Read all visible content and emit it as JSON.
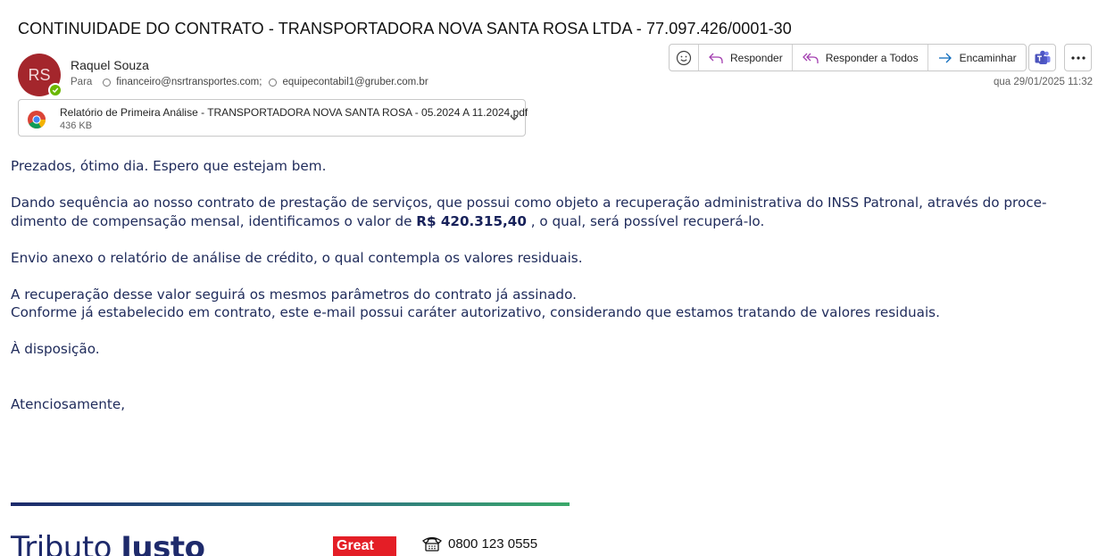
{
  "email": {
    "subject": "CONTINUIDADE DO CONTRATO - TRANSPORTADORA NOVA SANTA ROSA LTDA - 77.097.426/0001-30",
    "sender": {
      "initials": "RS",
      "name": "Raquel Souza",
      "avatar_color": "#a4262c",
      "presence_color": "#6bb700"
    },
    "to_label": "Para",
    "recipients": [
      "financeiro@nsrtransportes.com;",
      "equipecontabil1@gruber.com.br"
    ],
    "date": "qua 29/01/2025 11:32"
  },
  "toolbar": {
    "emoji_icon": "smiley-icon",
    "reply_label": "Responder",
    "reply_all_label": "Responder a Todos",
    "forward_label": "Encaminhar",
    "teams_icon": "teams-icon",
    "more_icon": "more-icon"
  },
  "attachment": {
    "name": "Relatório de Primeira Análise - TRANSPORTADORA NOVA SANTA ROSA - 05.2024 A 11.2024.pdf",
    "size": "436 KB",
    "icon": "chrome-icon"
  },
  "body": {
    "greeting": "Prezados, ótimo dia. Espero que estejam bem.",
    "p2_line1": "Dando sequência ao nosso contrato de prestação de serviços, que possui como objeto a recuperação administrativa do INSS Patronal, através do proce-",
    "p2_line2_pre": "dimento de compensação mensal, identificamos o valor de ",
    "p2_amount": "R$ 420.315,40",
    "p2_line2_post": " , o qual, será possível recuperá-lo.",
    "p3": "Envio anexo o relatório de análise de crédito, o qual contempla os valores residuais.",
    "p4_line1": "A recuperação desse valor seguirá os mesmos parâmetros do contrato já assinado.",
    "p4_line2": "Conforme já estabelecido em contrato, este e-mail possui caráter autorizativo, considerando que estamos tratando de valores residuais.",
    "p5": "À disposição.",
    "closing": "Atenciosamente,"
  },
  "signature": {
    "logo_light": "Tributo ",
    "logo_bold": "Justo",
    "badge": "Great",
    "phone": "0800 123 0555",
    "accent_start": "#1c2a6b",
    "accent_end": "#3aa86a"
  }
}
